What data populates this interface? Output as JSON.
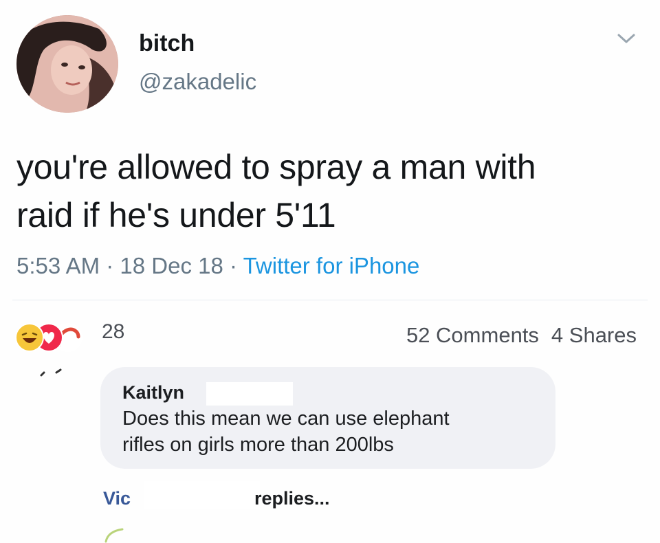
{
  "tweet": {
    "display_name": "bitch",
    "handle": "@zakadelic",
    "text_line1": "you're allowed to spray a man with",
    "text_line2": "raid if he's under 5'11",
    "time": "5:53 AM",
    "date": "18 Dec 18",
    "separator": " · ",
    "source": "Twitter for iPhone",
    "menu_icon": "chevron-down-icon",
    "accent_color": "#1b95e0"
  },
  "post": {
    "reactions": [
      "haha-icon",
      "love-icon",
      "like-icon"
    ],
    "reaction_count": "28",
    "comments": "52 Comments",
    "shares": "4 Shares"
  },
  "comment": {
    "author": "Kaitlyn ",
    "text_line1": "Does this mean we can use elephant",
    "text_line2": "rifles on girls more than 200lbs",
    "view_previous": "Vic",
    "view_replies": "replies..."
  }
}
